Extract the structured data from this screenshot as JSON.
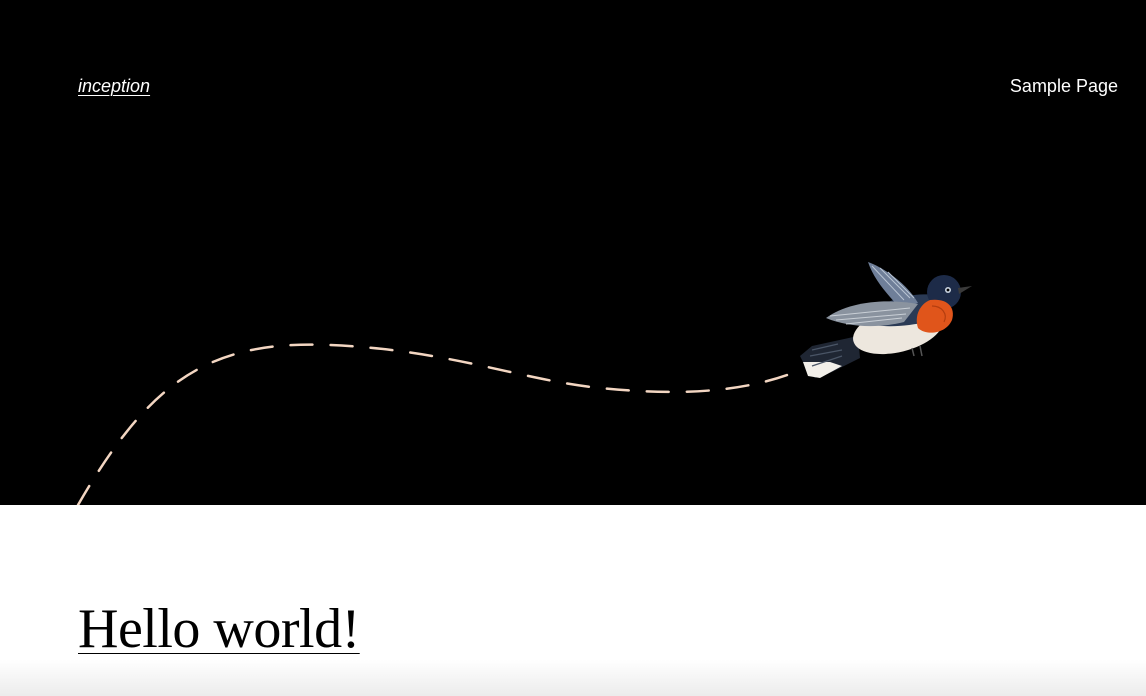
{
  "header": {
    "site_title": "inception",
    "nav": [
      {
        "label": "Sample Page"
      }
    ]
  },
  "hero": {
    "illustration": "bird-flight-path",
    "background_color": "#000000",
    "path_color": "#f3d6c2"
  },
  "post": {
    "title": "Hello world!"
  }
}
